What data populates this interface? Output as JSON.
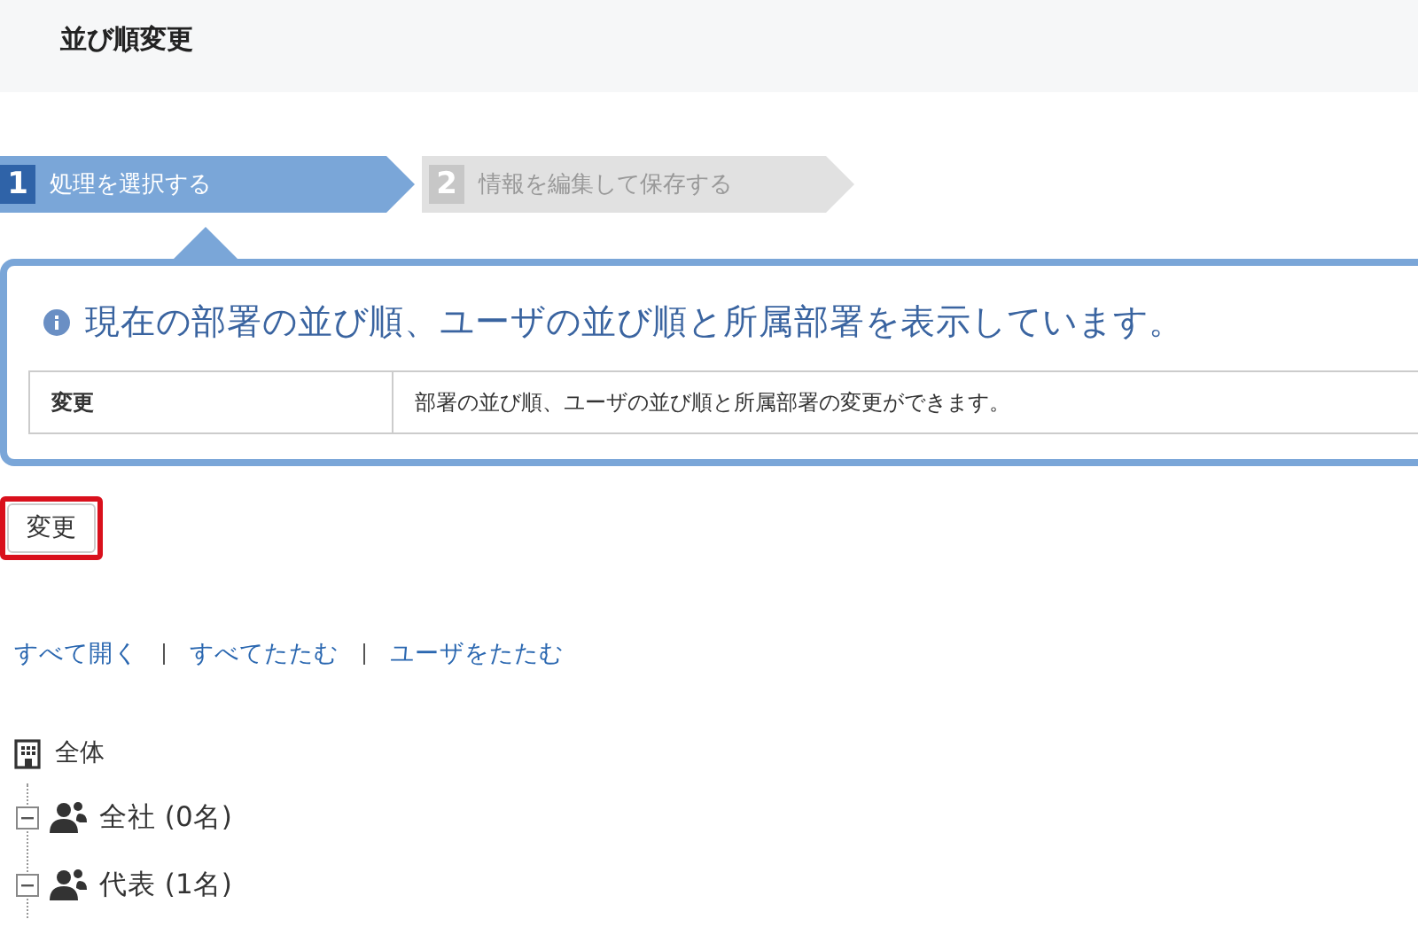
{
  "page_title": "並び順変更",
  "steps": [
    {
      "number": "1",
      "label": "処理を選択する",
      "selected": true
    },
    {
      "number": "2",
      "label": "情報を編集して保存する",
      "selected": false
    }
  ],
  "info": {
    "heading": "現在の部署の並び順、ユーザの並び順と所属部署を表示しています。",
    "rows": [
      {
        "name": "変更",
        "description": "部署の並び順、ユーザの並び順と所属部署の変更ができます。"
      }
    ]
  },
  "action_button": {
    "label": "変更",
    "highlighted": true
  },
  "links": [
    "すべて開く",
    "すべてたたむ",
    "ユーザをたたむ"
  ],
  "tree": {
    "label": "全体",
    "children": [
      {
        "label": "全社 (0名)",
        "expanded": true
      },
      {
        "label": "代表 (1名)",
        "expanded": true
      }
    ]
  }
}
